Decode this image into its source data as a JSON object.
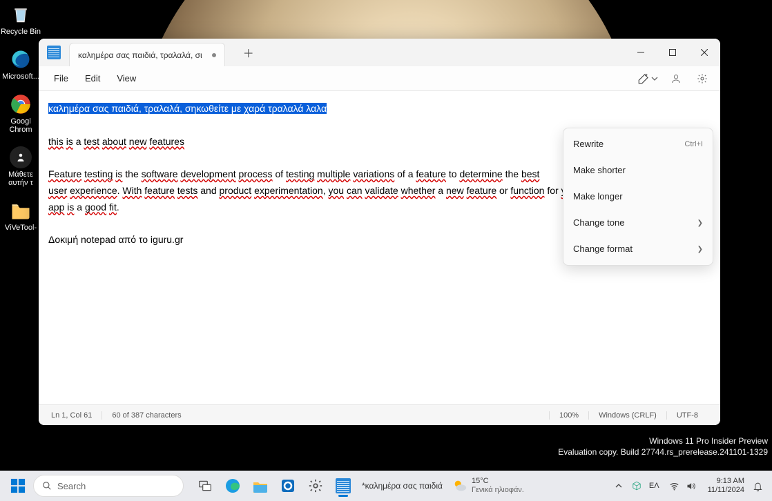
{
  "desktop": {
    "icons": [
      {
        "name": "recycle-bin",
        "label": "Recycle Bin"
      },
      {
        "name": "edge",
        "label": "Microsoft..."
      },
      {
        "name": "chrome",
        "label": "Googl\nChrom"
      },
      {
        "name": "learn",
        "label": "Μάθετε\nαυτήν τ"
      },
      {
        "name": "vivetool",
        "label": "ViVeTool-"
      }
    ]
  },
  "notepad": {
    "tab_title": "καλημέρα σας παιδιά, τραλαλά, σι",
    "menus": {
      "file": "File",
      "edit": "Edit",
      "view": "View"
    },
    "ai_menu": {
      "rewrite": "Rewrite",
      "rewrite_shortcut": "Ctrl+I",
      "shorter": "Make shorter",
      "longer": "Make longer",
      "tone": "Change tone",
      "format": "Change format"
    },
    "content": {
      "line1_hl": "καλημέρα σας παιδιά, τραλαλά, σηκωθείτε με χαρά τραλαλά λαλα",
      "line2_pre": "this is a test about new features",
      "para_text": "Feature testing is the software development process of testing multiple variations of a feature to determine the best user experience. With feature tests and product experimentation, you can validate whether a new feature or function for your app is a good fit.",
      "line5": "Δοκιμή notepad από το iguru.gr"
    },
    "status": {
      "pos": "Ln 1, Col 61",
      "sel": "60 of 387 characters",
      "zoom": "100%",
      "eol": "Windows (CRLF)",
      "enc": "UTF-8"
    }
  },
  "overlay": {
    "line1": "Windows 11 Pro Insider Preview",
    "line2": "Evaluation copy. Build 27744.rs_prerelease.241101-1329"
  },
  "taskbar": {
    "search_placeholder": "Search",
    "running_title": "*καλημέρα σας παιδιά",
    "weather_temp": "15°C",
    "weather_desc": "Γενικά ηλιοφάν.",
    "lang": "ΕΛ",
    "time": "9:13 AM",
    "date": "11/11/2024"
  }
}
